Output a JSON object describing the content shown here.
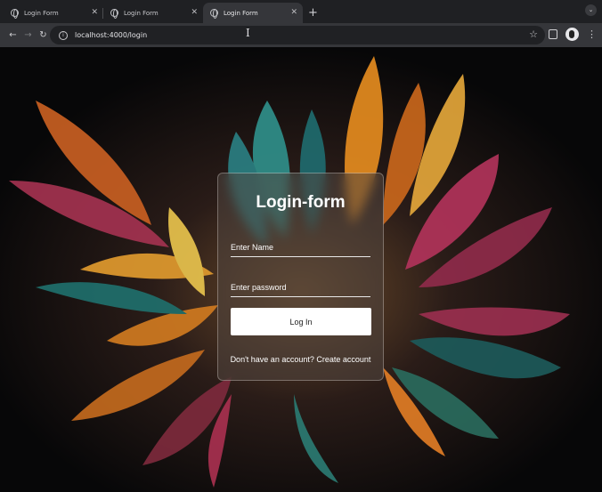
{
  "browser": {
    "tabs": [
      {
        "title": "Login Form",
        "active": false
      },
      {
        "title": "Login Form",
        "active": false
      },
      {
        "title": "Login Form",
        "active": true
      }
    ],
    "new_tab_glyph": "+",
    "url": "localhost:4000/login"
  },
  "login": {
    "title": "Login-form",
    "name_placeholder": "Enter Name",
    "password_placeholder": "Enter password",
    "button_label": "Log In",
    "signup_prompt": "Don't have an account?",
    "signup_link": "Create account"
  },
  "colors": {
    "chrome_dark": "#1f2023",
    "toolbar": "#35363a",
    "accent_orange": "#e08a1e",
    "accent_teal": "#2e9a92",
    "accent_magenta": "#b1335a"
  }
}
